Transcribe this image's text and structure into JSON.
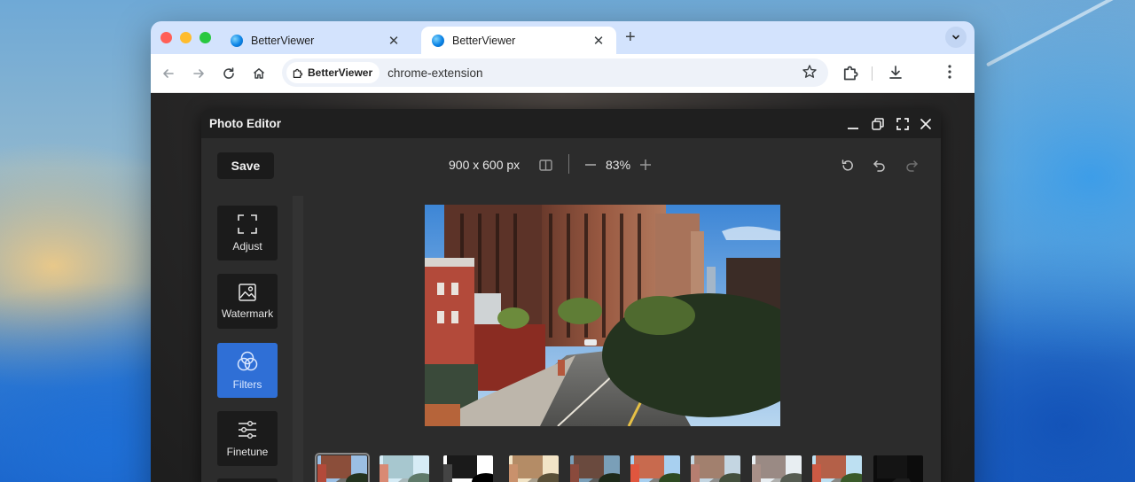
{
  "browser": {
    "tabs": [
      {
        "title": "BetterViewer",
        "active": false
      },
      {
        "title": "BetterViewer",
        "active": true
      }
    ],
    "new_tab_label": "+",
    "site_chip": "BetterViewer",
    "url": "chrome-extension"
  },
  "editor": {
    "title": "Photo Editor",
    "save_label": "Save",
    "dimensions": "900 x 600 px",
    "zoom": "83%",
    "tools": [
      {
        "label": "Adjust",
        "icon": "crop-icon",
        "active": false
      },
      {
        "label": "Watermark",
        "icon": "image-frame-icon",
        "active": false
      },
      {
        "label": "Filters",
        "icon": "overlapping-circles-icon",
        "active": true
      },
      {
        "label": "Finetune",
        "icon": "sliders-icon",
        "active": false
      }
    ],
    "filters": [
      "original",
      "filter-2",
      "filter-3",
      "filter-4",
      "filter-5",
      "filter-6",
      "filter-7",
      "filter-8",
      "filter-9",
      "filter-10"
    ]
  },
  "colors": {
    "tabstrip": "#d3e3fd",
    "editor_bg": "#2c2c2c",
    "active_tool": "#2f6fd6",
    "tool_bg": "#1b1b1b"
  }
}
